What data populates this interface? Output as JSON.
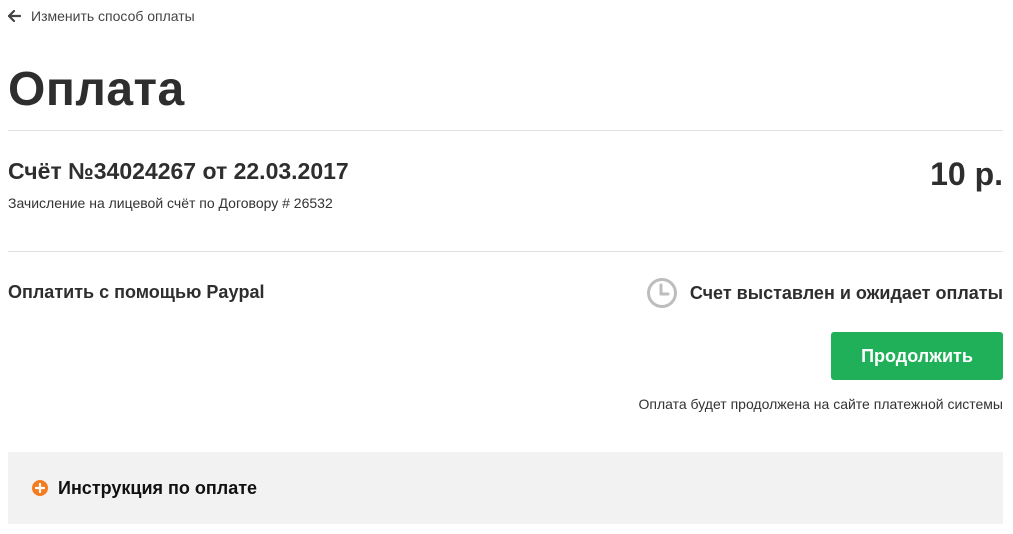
{
  "nav": {
    "back_label": "Изменить способ оплаты"
  },
  "page": {
    "title": "Оплата"
  },
  "invoice": {
    "title": "Счёт №34024267 от 22.03.2017",
    "description": "Зачисление на лицевой счёт по Договору # 26532",
    "amount": "10 р."
  },
  "payment": {
    "method_label": "Оплатить с помощью Paypal",
    "status_text": "Счет выставлен и ожидает оплаты",
    "status_icon": "clock-icon",
    "continue_label": "Продолжить",
    "continue_note": "Оплата будет продолжена на сайте платежной системы"
  },
  "instructions": {
    "label": "Инструкция по оплате",
    "icon": "plus-circle-icon"
  },
  "colors": {
    "accent_green": "#21b05a",
    "accent_orange": "#f47c20",
    "panel_bg": "#f2f2f2"
  }
}
